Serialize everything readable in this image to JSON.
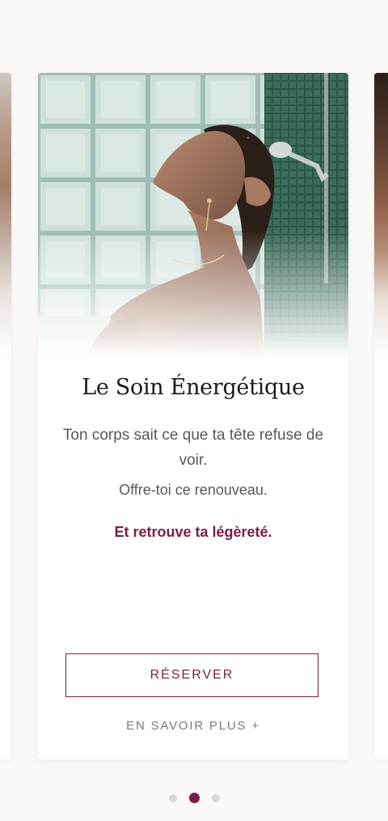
{
  "card": {
    "title": "Le Soin Énergétique",
    "description": "Ton corps sait ce que ta tête refuse de voir.",
    "offer": "Offre-toi ce renouveau.",
    "tagline": "Et retrouve ta légèreté.",
    "reserve_label": "RÉSERVER",
    "more_label": "EN SAVOIR PLUS +",
    "image_alt": "woman-in-shower-photo"
  },
  "carousel": {
    "total_slides": 3,
    "active_slide": 2
  },
  "colors": {
    "accent": "#7a1f45",
    "text": "#5b5757",
    "title": "#1c1a1a",
    "background": "#fbf9f7"
  }
}
